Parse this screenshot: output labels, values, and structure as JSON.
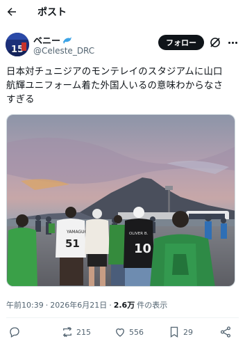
{
  "header": {
    "title": "ポスト",
    "back_icon": "arrow-left-icon"
  },
  "author": {
    "display_name": "ベニー",
    "name_emoji": "dolphin-icon",
    "handle": "@Celeste_DRC",
    "avatar_number": "15",
    "follow_label": "フォロー"
  },
  "tweet": {
    "text_lines": [
      "日本対チュニジアのモンテレイのスタジアムに山口",
      "航輝ユニフォーム着た外国人いるの意味わからなさ",
      "すぎる"
    ],
    "jersey_numbers": [
      "51",
      "10"
    ],
    "jersey_names": [
      "YAMAGUCHI",
      "OLIVER B."
    ]
  },
  "meta": {
    "time": "午前10:39",
    "separator": "·",
    "date": "2026年6月21日",
    "views_count": "2.6万",
    "views_label": "件の表示"
  },
  "actions": {
    "replies": "",
    "retweets": "215",
    "likes": "556",
    "bookmarks": "29"
  },
  "colors": {
    "text": "#0f1419",
    "secondary": "#536471",
    "follow_bg": "#0f1419",
    "accent": "#1d9bf0"
  }
}
